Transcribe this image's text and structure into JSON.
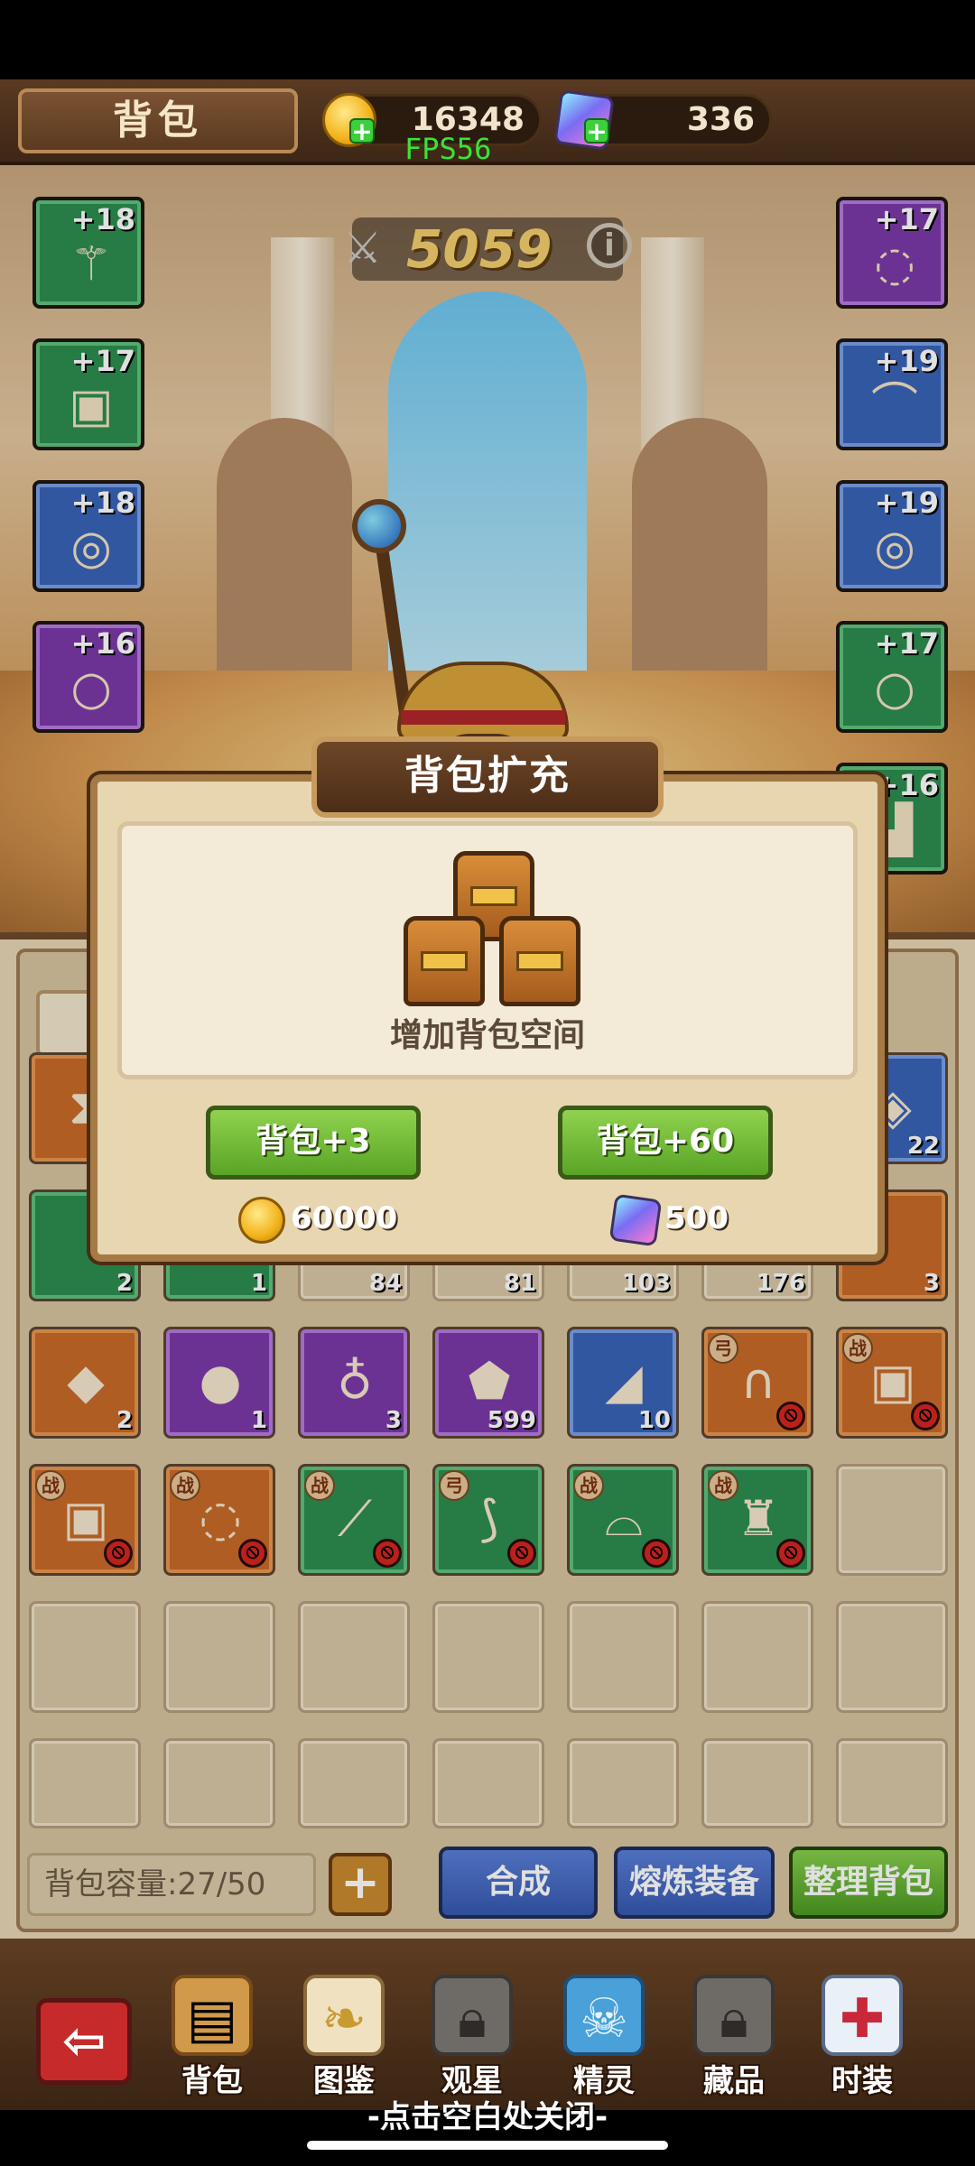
{
  "header": {
    "title": "背包",
    "gold": "16348",
    "gems": "336",
    "fps": "FPS56"
  },
  "combat_power": "5059",
  "equipment_left": [
    {
      "level": "+18",
      "rarity": "green",
      "icon": "staff"
    },
    {
      "level": "+17",
      "rarity": "green",
      "icon": "armor"
    },
    {
      "level": "+18",
      "rarity": "blue",
      "icon": "bracelet"
    },
    {
      "level": "+16",
      "rarity": "purple",
      "icon": "ring"
    }
  ],
  "equipment_right": [
    {
      "level": "+17",
      "rarity": "purple",
      "icon": "necklace"
    },
    {
      "level": "+19",
      "rarity": "blue",
      "icon": "hat"
    },
    {
      "level": "+19",
      "rarity": "blue",
      "icon": "bracelet"
    },
    {
      "level": "+17",
      "rarity": "green",
      "icon": "ring"
    },
    {
      "level": "+16",
      "rarity": "green",
      "icon": "boots"
    }
  ],
  "inventory": {
    "row_counts": [
      "2",
      "1",
      "84",
      "81",
      "103",
      "176",
      "3"
    ],
    "row_tr_count": "22",
    "row3": [
      {
        "count": "2",
        "rarity": "orange",
        "icon": "gold-ore",
        "tag": ""
      },
      {
        "count": "1",
        "rarity": "purple",
        "icon": "orb",
        "tag": ""
      },
      {
        "count": "3",
        "rarity": "purple",
        "icon": "potion",
        "tag": ""
      },
      {
        "count": "599",
        "rarity": "purple",
        "icon": "stone",
        "tag": ""
      },
      {
        "count": "10",
        "rarity": "blue",
        "icon": "scroll",
        "tag": ""
      },
      {
        "count": "",
        "rarity": "orange",
        "icon": "whip",
        "tag": "弓"
      },
      {
        "count": "",
        "rarity": "orange",
        "icon": "armor",
        "tag": "战"
      }
    ],
    "row4": [
      {
        "rarity": "orange",
        "icon": "armor",
        "tag": "战"
      },
      {
        "rarity": "orange",
        "icon": "necklace",
        "tag": "战"
      },
      {
        "rarity": "green",
        "icon": "sword",
        "tag": "战"
      },
      {
        "rarity": "green",
        "icon": "bow",
        "tag": "弓"
      },
      {
        "rarity": "green",
        "icon": "helmet",
        "tag": "战"
      },
      {
        "rarity": "green",
        "icon": "warrior",
        "tag": "战"
      }
    ],
    "capacity_label": "背包容量:27/50",
    "buttons": {
      "merge": "合成",
      "smelt": "熔炼装备",
      "sort": "整理背包"
    }
  },
  "dialog": {
    "title": "背包扩充",
    "subtitle": "增加背包空间",
    "option_small": {
      "label": "背包+3",
      "price": "60000",
      "currency": "gold"
    },
    "option_large": {
      "label": "背包+60",
      "price": "500",
      "currency": "gem"
    }
  },
  "nav": {
    "items": [
      "背包",
      "图鉴",
      "观星",
      "精灵",
      "藏品",
      "时装"
    ]
  },
  "close_hint": "-点击空白处关闭-",
  "colors": {
    "gold": "#f2b21a",
    "green_btn": "#5aa426",
    "blue_btn": "#3658b0",
    "exit": "#c72a2a"
  }
}
